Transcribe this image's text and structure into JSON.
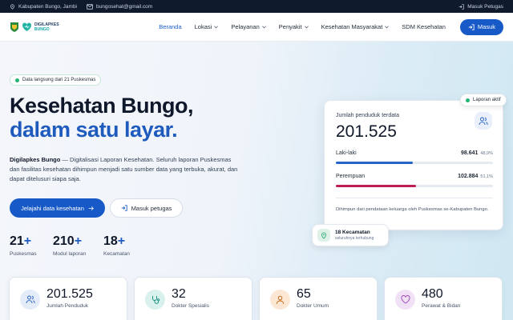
{
  "topbar": {
    "location": "Kabupaten Bungo, Jambi",
    "email": "bungosehat@gmail.com",
    "login_link": "Masuk Petugas"
  },
  "navbar": {
    "logo_line1": "DIGILAPKES",
    "logo_line2": "BUNGO",
    "menu": [
      {
        "label": "Beranda",
        "dropdown": false,
        "active": true
      },
      {
        "label": "Lokasi",
        "dropdown": true
      },
      {
        "label": "Pelayanan",
        "dropdown": true
      },
      {
        "label": "Penyakit",
        "dropdown": true
      },
      {
        "label": "Kesehatan Masyarakat",
        "dropdown": true
      },
      {
        "label": "SDM Kesehatan",
        "dropdown": false
      }
    ],
    "login_button": "Masuk"
  },
  "hero": {
    "badge": "Data langsung dari 21 Puskesmas",
    "title_line1": "Kesehatan Bungo,",
    "title_line2": "dalam satu layar.",
    "desc_brand": "Digilapkes Bungo",
    "desc_rest": " — Digitalisasi Laporan Kesehatan. Seluruh laporan Puskesmas dan fasilitas kesehatan dihimpun menjadi satu sumber data yang terbuka, akurat, dan dapat ditelusuri siapa saja.",
    "cta_primary": "Jelajahi data kesehatan",
    "cta_secondary": "Masuk petugas"
  },
  "stats": [
    {
      "value": "21",
      "suffix": "+",
      "label": "Puskesmas"
    },
    {
      "value": "210",
      "suffix": "+",
      "label": "Modul laporan"
    },
    {
      "value": "18",
      "suffix": "+",
      "label": "Kecamatan"
    }
  ],
  "population_card": {
    "title": "Jumlah penduduk terdata",
    "total": "201.525",
    "male_label": "Laki-laki",
    "male_value": "98.641",
    "male_pct": "48,9%",
    "male_fraction": 0.489,
    "female_label": "Perempuan",
    "female_value": "102.884",
    "female_pct": "51,1%",
    "female_fraction": 0.511,
    "footnote": "Dihimpun dari pendataan keluarga oleh Puskesmas se-Kabupaten Bungo.",
    "status_pill": "Laporan aktif",
    "colors": {
      "male": "#2563c9",
      "female": "#be1e56"
    }
  },
  "kecamatan_card": {
    "title": "18 Kecamatan",
    "subtitle": "seluruhnya terhubung"
  },
  "summary_cards": [
    {
      "value": "201.525",
      "label": "Jumlah Penduduk",
      "icon": "users-icon",
      "color": "#e4ecfa"
    },
    {
      "value": "32",
      "label": "Dokter Spesialis",
      "icon": "stethoscope-icon",
      "color": "#d8f1ec"
    },
    {
      "value": "65",
      "label": "Dokter Umum",
      "icon": "doctor-icon",
      "color": "#fbe7d4"
    },
    {
      "value": "480",
      "label": "Perawat & Bidan",
      "icon": "heart-icon",
      "color": "#f1e1f6"
    }
  ]
}
